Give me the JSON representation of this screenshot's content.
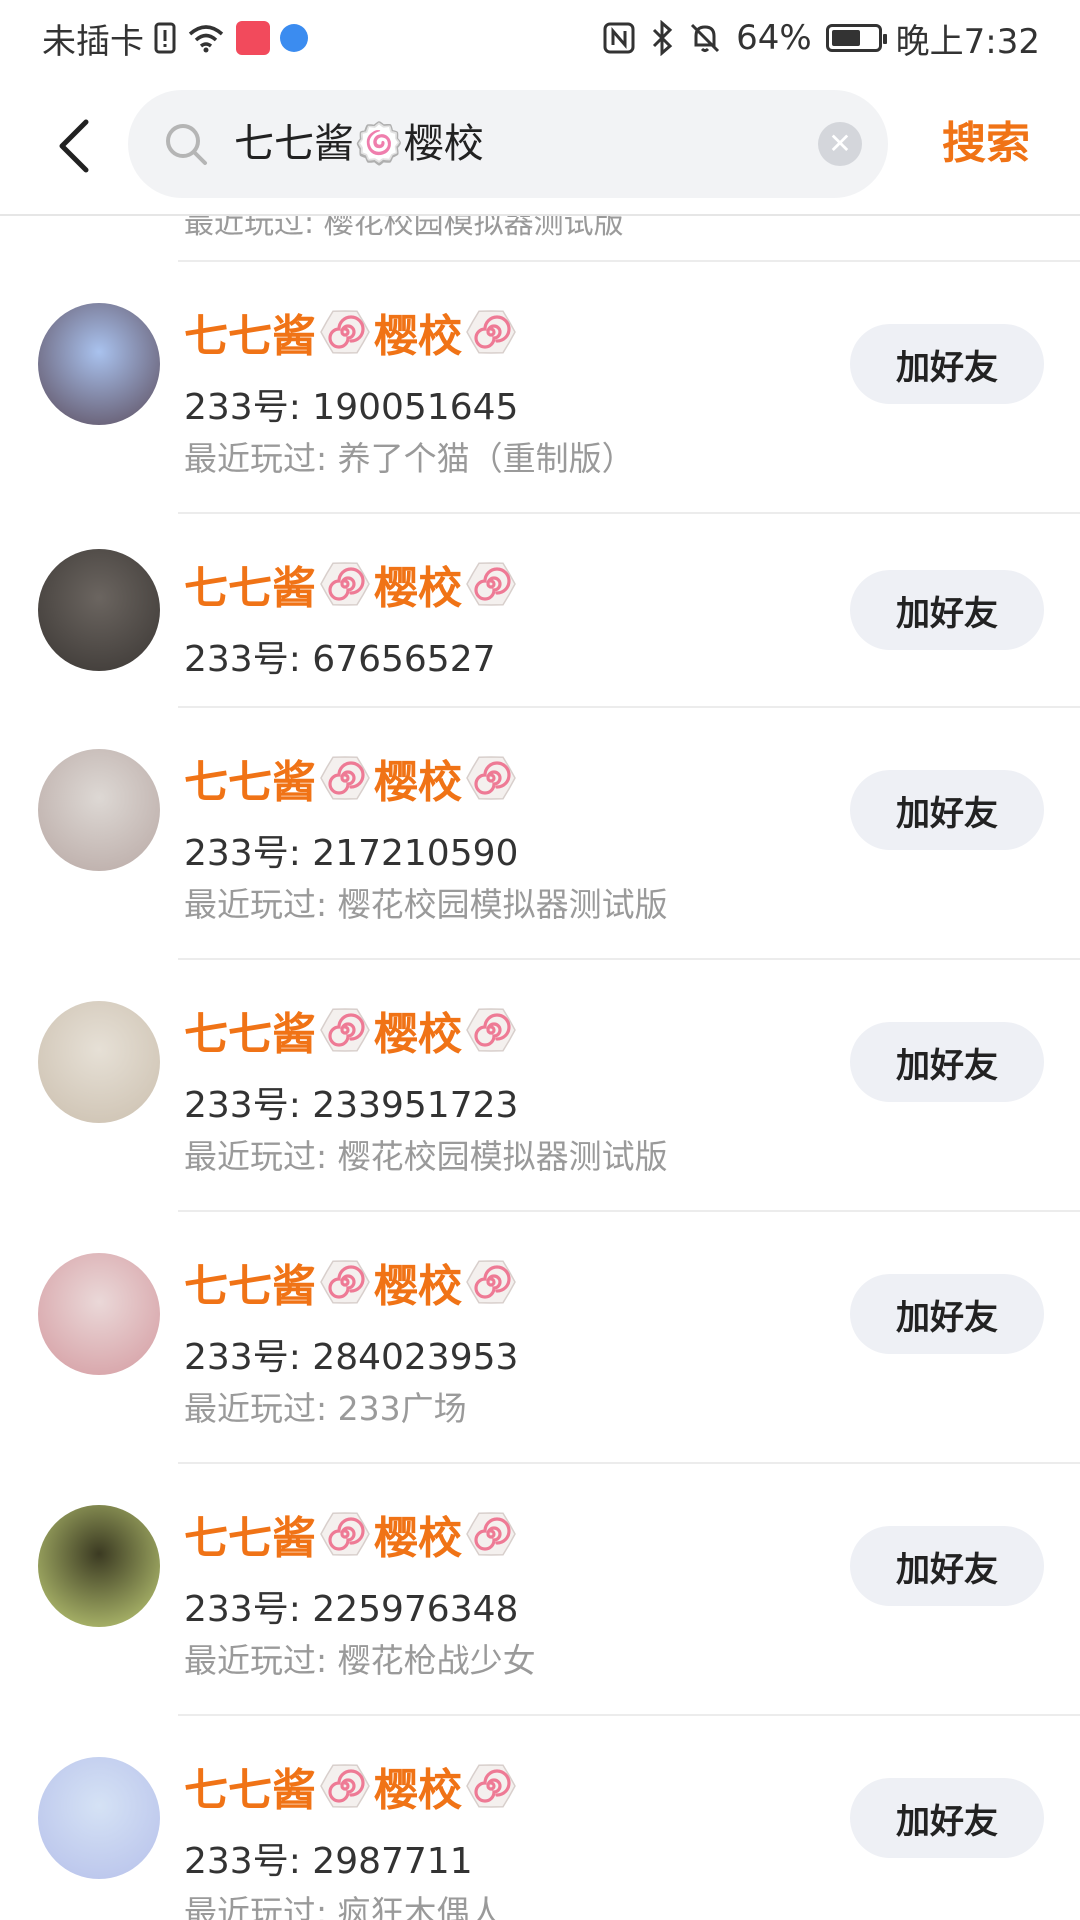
{
  "status_bar": {
    "carrier": "未插卡",
    "battery": "64%",
    "battery_level": 0.64,
    "time": "晚上7:32"
  },
  "header": {
    "search_query": "七七酱🍥樱校",
    "search_button": "搜索"
  },
  "partial_row_text": "最近玩过: 樱花校园模拟器测试版",
  "results": [
    {
      "name_a": "七七酱",
      "name_b": "樱校",
      "uid": "233号: 190051645",
      "played": "最近玩过: 养了个猫（重制版）",
      "button": "加好友",
      "avatar_colors": [
        "#a9c2ee",
        "#5a4a5a"
      ]
    },
    {
      "name_a": "七七酱",
      "name_b": "樱校",
      "uid": "233号: 67656527",
      "played": "",
      "button": "加好友",
      "avatar_colors": [
        "#6b6560",
        "#3a3633"
      ]
    },
    {
      "name_a": "七七酱",
      "name_b": "樱校",
      "uid": "233号: 217210590",
      "played": "最近玩过: 樱花校园模拟器测试版",
      "button": "加好友",
      "avatar_colors": [
        "#ddd8d4",
        "#b8a8a4"
      ]
    },
    {
      "name_a": "七七酱",
      "name_b": "樱校",
      "uid": "233号: 233951723",
      "played": "最近玩过: 樱花校园模拟器测试版",
      "button": "加好友",
      "avatar_colors": [
        "#e6e0d6",
        "#cbbfae"
      ]
    },
    {
      "name_a": "七七酱",
      "name_b": "樱校",
      "uid": "233号: 284023953",
      "played": "最近玩过: 233广场",
      "button": "加好友",
      "avatar_colors": [
        "#ead8d8",
        "#d49aa0"
      ]
    },
    {
      "name_a": "七七酱",
      "name_b": "樱校",
      "uid": "233号: 225976348",
      "played": "最近玩过: 樱花枪战少女",
      "button": "加好友",
      "avatar_colors": [
        "#3b3a22",
        "#c4d27a"
      ]
    },
    {
      "name_a": "七七酱",
      "name_b": "樱校",
      "uid": "233号: 2987711",
      "played": "最近玩过: 疯狂木偶人",
      "button": "加好友",
      "avatar_colors": [
        "#d5e2f5",
        "#b6c0ea"
      ]
    }
  ]
}
